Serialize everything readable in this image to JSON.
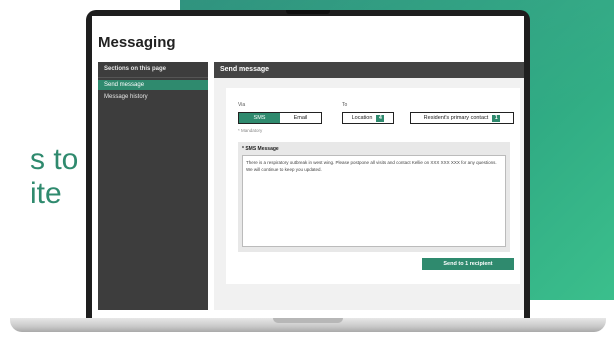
{
  "background": {
    "accent_color": "#2f8a6e",
    "headline_line1": "s to",
    "headline_line2": "ite"
  },
  "app": {
    "title": "Messaging"
  },
  "sidebar": {
    "header": "Sections on this page",
    "items": [
      {
        "label": "Send message",
        "active": true
      },
      {
        "label": "Message history",
        "active": false
      }
    ]
  },
  "main": {
    "header": "Send message",
    "via_label": "Via",
    "to_label": "To",
    "via_options": [
      {
        "label": "SMS",
        "active": true
      },
      {
        "label": "Email",
        "active": false
      }
    ],
    "to_options": [
      {
        "label": "Location",
        "count": "4"
      },
      {
        "label": "Resident's primary contact",
        "count": "1"
      }
    ],
    "mandatory_text": "* Mandatory",
    "sms_label": "* SMS Message",
    "sms_text": "There is a respiratory outbreak in west wing. Please postpone all visits and contact Kellie on XXX XXX XXX for any questions. We will continue to keep you updated.",
    "send_button": "Send to 1 recipient"
  }
}
